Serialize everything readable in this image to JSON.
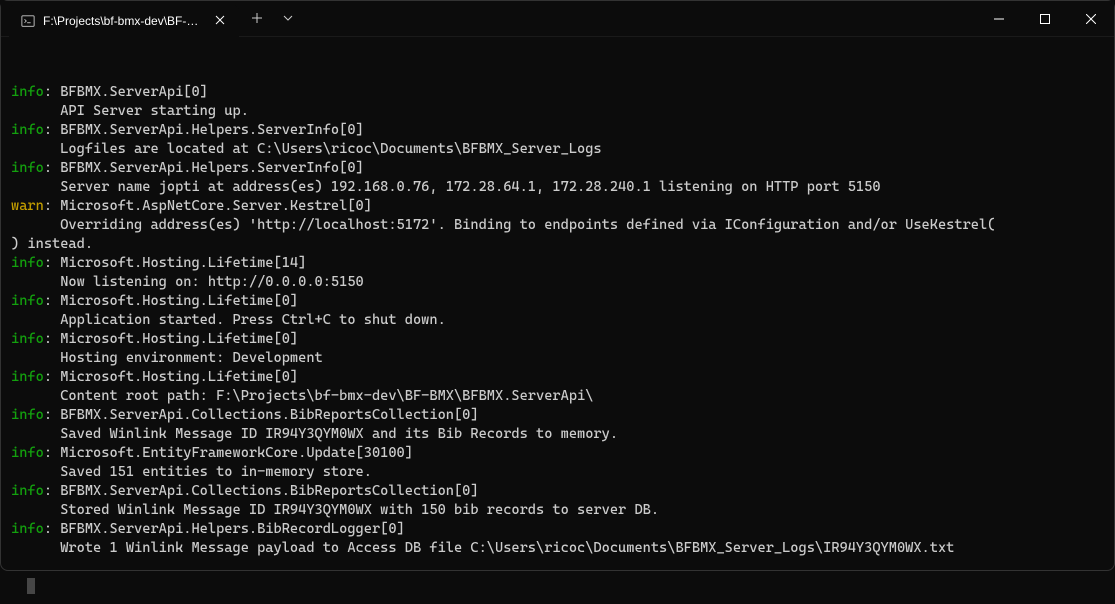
{
  "tab": {
    "title": "F:\\Projects\\bf-bmx-dev\\BF-BM"
  },
  "lines": [
    {
      "level": "info",
      "head": "BFBMX.ServerApi[0]",
      "body": "API Server starting up."
    },
    {
      "level": "info",
      "head": "BFBMX.ServerApi.Helpers.ServerInfo[0]",
      "body": "Logfiles are located at C:\\Users\\ricoc\\Documents\\BFBMX_Server_Logs"
    },
    {
      "level": "info",
      "head": "BFBMX.ServerApi.Helpers.ServerInfo[0]",
      "body": "Server name jopti at address(es) 192.168.0.76, 172.28.64.1, 172.28.240.1 listening on HTTP port 5150"
    },
    {
      "level": "warn",
      "head": "Microsoft.AspNetCore.Server.Kestrel[0]",
      "body": "Overriding address(es) 'http://localhost:5172'. Binding to endpoints defined via IConfiguration and/or UseKestrel(\n) instead."
    },
    {
      "level": "info",
      "head": "Microsoft.Hosting.Lifetime[14]",
      "body": "Now listening on: http://0.0.0.0:5150"
    },
    {
      "level": "info",
      "head": "Microsoft.Hosting.Lifetime[0]",
      "body": "Application started. Press Ctrl+C to shut down."
    },
    {
      "level": "info",
      "head": "Microsoft.Hosting.Lifetime[0]",
      "body": "Hosting environment: Development"
    },
    {
      "level": "info",
      "head": "Microsoft.Hosting.Lifetime[0]",
      "body": "Content root path: F:\\Projects\\bf-bmx-dev\\BF-BMX\\BFBMX.ServerApi\\"
    },
    {
      "level": "info",
      "head": "BFBMX.ServerApi.Collections.BibReportsCollection[0]",
      "body": "Saved Winlink Message ID IR94Y3QYM0WX and its Bib Records to memory."
    },
    {
      "level": "info",
      "head": "Microsoft.EntityFrameworkCore.Update[30100]",
      "body": "Saved 151 entities to in-memory store."
    },
    {
      "level": "info",
      "head": "BFBMX.ServerApi.Collections.BibReportsCollection[0]",
      "body": "Stored Winlink Message ID IR94Y3QYM0WX with 150 bib records to server DB."
    },
    {
      "level": "info",
      "head": "BFBMX.ServerApi.Helpers.BibRecordLogger[0]",
      "body": "Wrote 1 Winlink Message payload to Access DB file C:\\Users\\ricoc\\Documents\\BFBMX_Server_Logs\\IR94Y3QYM0WX.txt"
    }
  ]
}
